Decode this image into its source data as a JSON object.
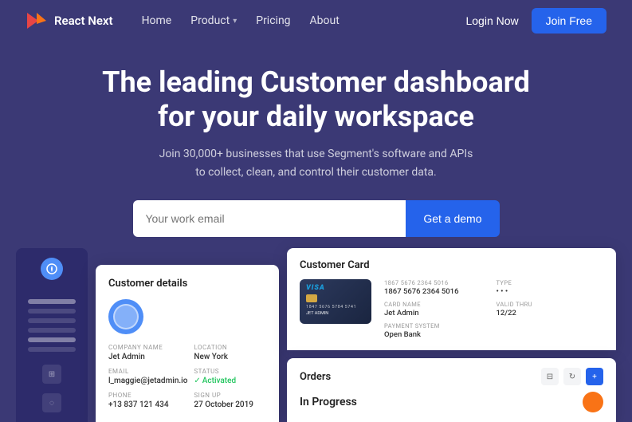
{
  "brand": {
    "name": "React Next",
    "logo_text": "React Next"
  },
  "navbar": {
    "links": [
      {
        "label": "Home",
        "has_dropdown": false
      },
      {
        "label": "Product",
        "has_dropdown": true
      },
      {
        "label": "Pricing",
        "has_dropdown": false
      },
      {
        "label": "About",
        "has_dropdown": false
      }
    ],
    "login_label": "Login Now",
    "join_label": "Join Free"
  },
  "hero": {
    "headline_line1": "The leading Customer dashboard",
    "headline_line2": "for your daily workspace",
    "subtext": "Join 30,000+ businesses that use Segment's software and APIs to collect, clean, and control their customer data.",
    "email_placeholder": "Your work email",
    "cta_label": "Get a demo"
  },
  "customer_details": {
    "title": "Customer details",
    "company_label": "COMPANY NAME",
    "company_value": "Jet Admin",
    "location_label": "LOCATION",
    "location_value": "New York",
    "status_label": "STATUS",
    "status_value": "Activated",
    "email_label": "EMAIL",
    "email_value": "l_maggie@jetadmin.io",
    "phone_label": "PHONE",
    "phone_value": "+13 837 121 434",
    "signup_label": "SIGN UP",
    "signup_value": "27 October 2019"
  },
  "customer_card": {
    "title": "Customer Card",
    "card_brand": "VISA",
    "card_number": "1867 5676 2364 5016",
    "card_type_label": "TYPE",
    "card_type_value": "• • •",
    "card_name_label": "CARD NAME",
    "card_name_value": "Jet Admin",
    "card_expiry_label": "VALID THRU",
    "card_expiry_value": "12/22",
    "payment_system_label": "PAYMENT SYSTEM",
    "payment_system_value": "Open Bank"
  },
  "orders": {
    "title": "Orders",
    "filter_icon": "filter",
    "refresh_icon": "refresh",
    "add_icon": "+",
    "status": "In Progress"
  },
  "colors": {
    "bg": "#3b3975",
    "accent": "#2563eb",
    "green": "#22c55e"
  }
}
